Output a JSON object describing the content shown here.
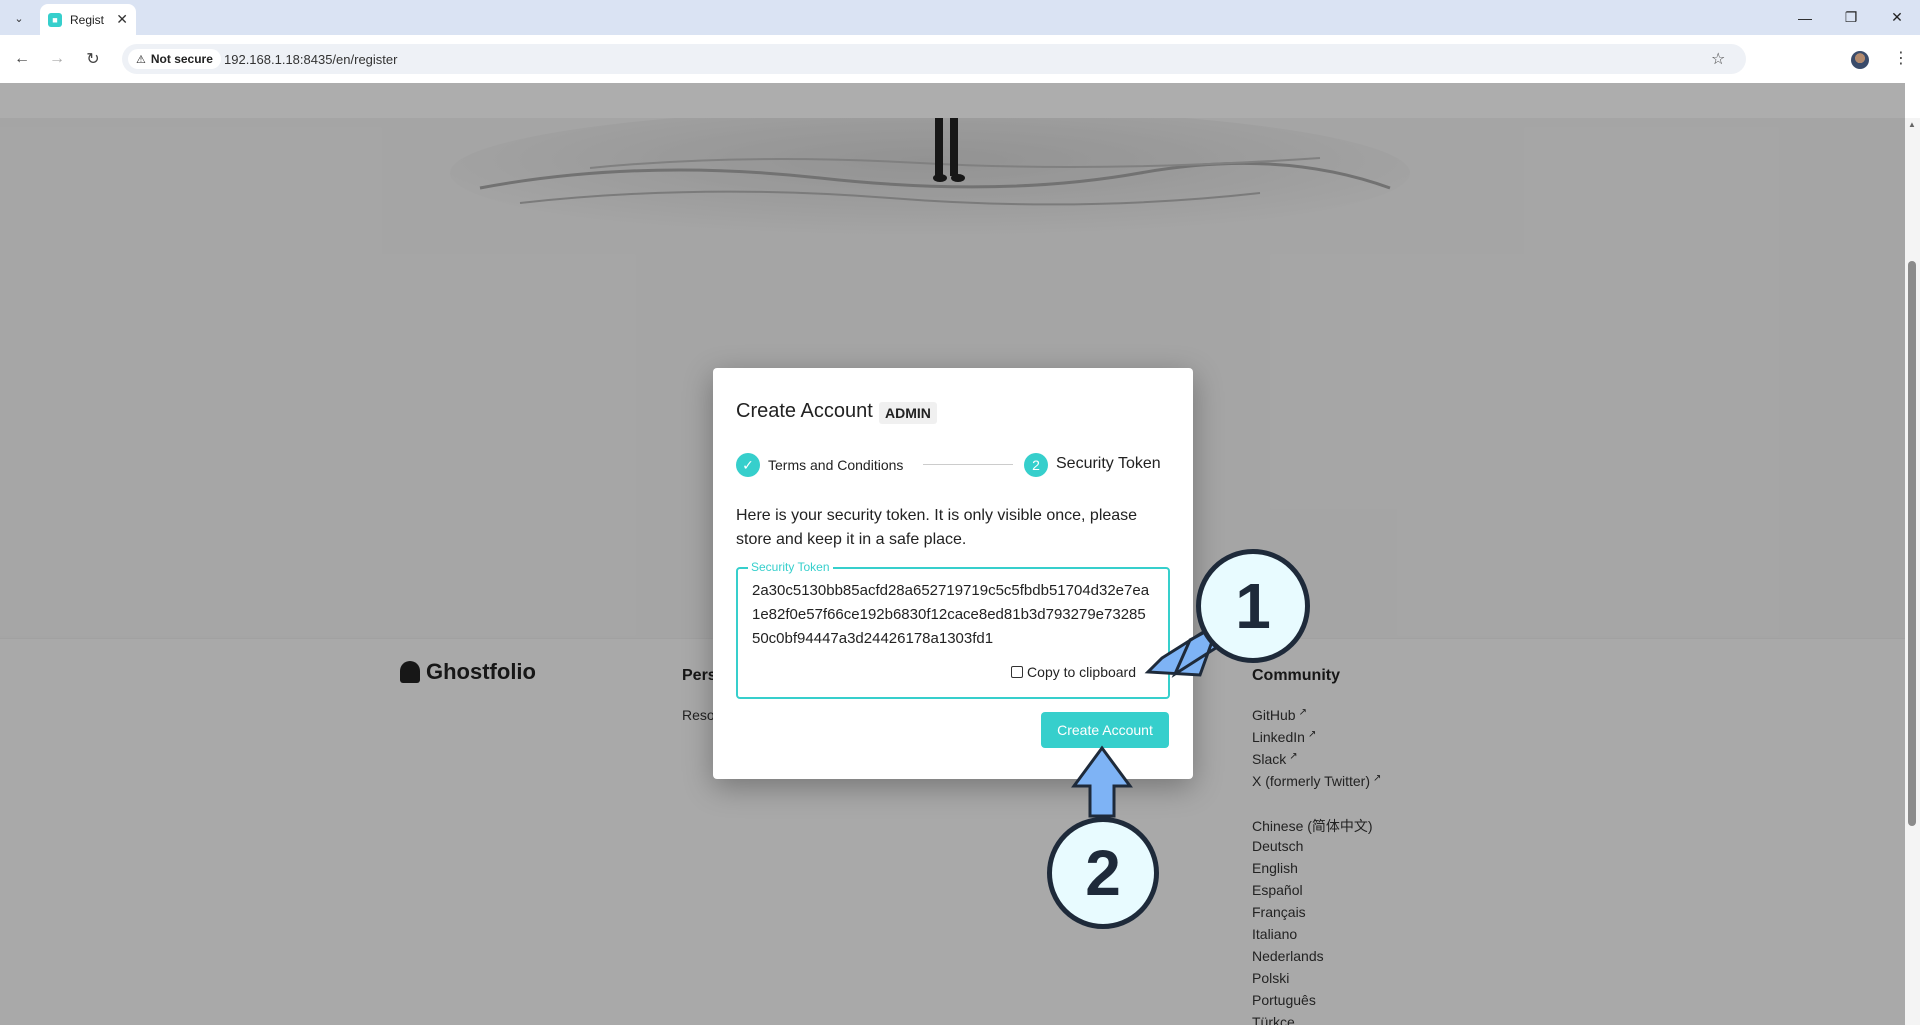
{
  "browser": {
    "tab_title": "Regist",
    "security_label": "Not secure",
    "url": "192.168.1.18:8435/en/register"
  },
  "footer": {
    "brand": "Ghostfolio",
    "col2_head": "Pers",
    "col2_link": "Reso",
    "community_head": "Community",
    "community_links": [
      "GitHub",
      "LinkedIn",
      "Slack",
      "X (formerly Twitter)"
    ],
    "languages": [
      "Chinese (简体中文)",
      "Deutsch",
      "English",
      "Español",
      "Français",
      "Italiano",
      "Nederlands",
      "Polski",
      "Português",
      "Türkçe"
    ]
  },
  "dialog": {
    "title": "Create Account",
    "badge": "ADMIN",
    "step1": "Terms and Conditions",
    "step2_number": "2",
    "step2": "Security Token",
    "message": "Here is your security token. It is only visible once, please store and keep it in a safe place.",
    "token_label": "Security Token",
    "token_value": "2a30c5130bb85acfd28a652719719c5c5fbdb51704d32e7ea1e82f0e57f66ce192b6830f12cace8ed81b3d793279e7328550c0bf94447a3d24426178a1303fd1",
    "copy_label": "Copy to clipboard",
    "create_label": "Create Account"
  },
  "annotations": [
    "1",
    "2"
  ],
  "colors": {
    "accent": "#36cfcc",
    "annotation_fill": "#e8fbff",
    "annotation_stroke": "#1e2a3a",
    "arrow": "#7eb3f5"
  },
  "icons": [
    "chevron-down-icon",
    "close-icon",
    "back-icon",
    "forward-icon",
    "reload-icon",
    "warning-icon",
    "star-icon",
    "kebab-icon",
    "check-icon",
    "copy-icon",
    "external-link-icon",
    "ghost-icon"
  ]
}
